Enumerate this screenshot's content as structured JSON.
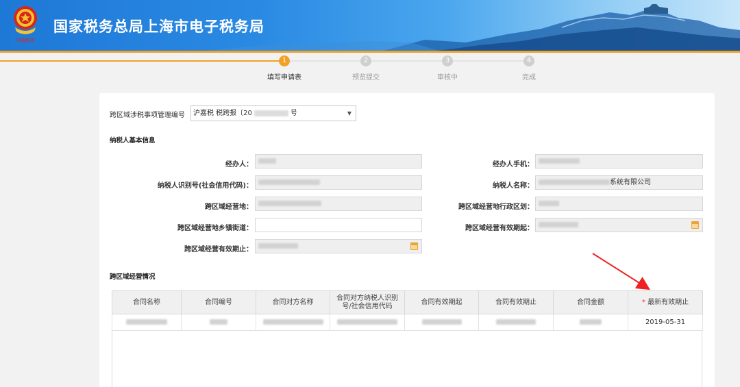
{
  "header": {
    "site_title": "国家税务总局上海市电子税务局",
    "brand_colors": {
      "header_blue": "#1e78d6",
      "accent_orange": "#f2a126"
    }
  },
  "steps": [
    {
      "num": "1",
      "label": "填写申请表",
      "active": true
    },
    {
      "num": "2",
      "label": "预览提交",
      "active": false
    },
    {
      "num": "3",
      "label": "审核中",
      "active": false
    },
    {
      "num": "4",
      "label": "完成",
      "active": false
    }
  ],
  "form": {
    "mgmt_no_label": "跨区域涉税事项管理编号",
    "mgmt_no_value_prefix": "沪嘉税 税跨报〔20",
    "mgmt_no_value_suffix": "号",
    "basic_section_title": "纳税人基本信息",
    "fields": {
      "operator_label": "经办人：",
      "operator_phone_label": "经办人手机：",
      "taxpayer_id_label": "纳税人识别号(社会信用代码)：",
      "taxpayer_name_label": "纳税人名称：",
      "taxpayer_name_suffix": "系统有限公司",
      "cross_place_label": "跨区域经营地：",
      "cross_district_label": "跨区域经营地行政区划：",
      "cross_street_label": "跨区域经营地乡镇街道：",
      "valid_from_label": "跨区域经营有效期起：",
      "valid_to_label": "跨区域经营有效期止："
    }
  },
  "contracts": {
    "section_title": "跨区域经营情况",
    "columns": [
      "合同名称",
      "合同编号",
      "合同对方名称",
      "合同对方纳税人识别号/社会信用代码",
      "合同有效期起",
      "合同有效期止",
      "合同金额",
      "最新有效期止"
    ],
    "required_mark": "*",
    "rows": [
      {
        "latest_valid_to": "2019-05-31"
      }
    ]
  }
}
